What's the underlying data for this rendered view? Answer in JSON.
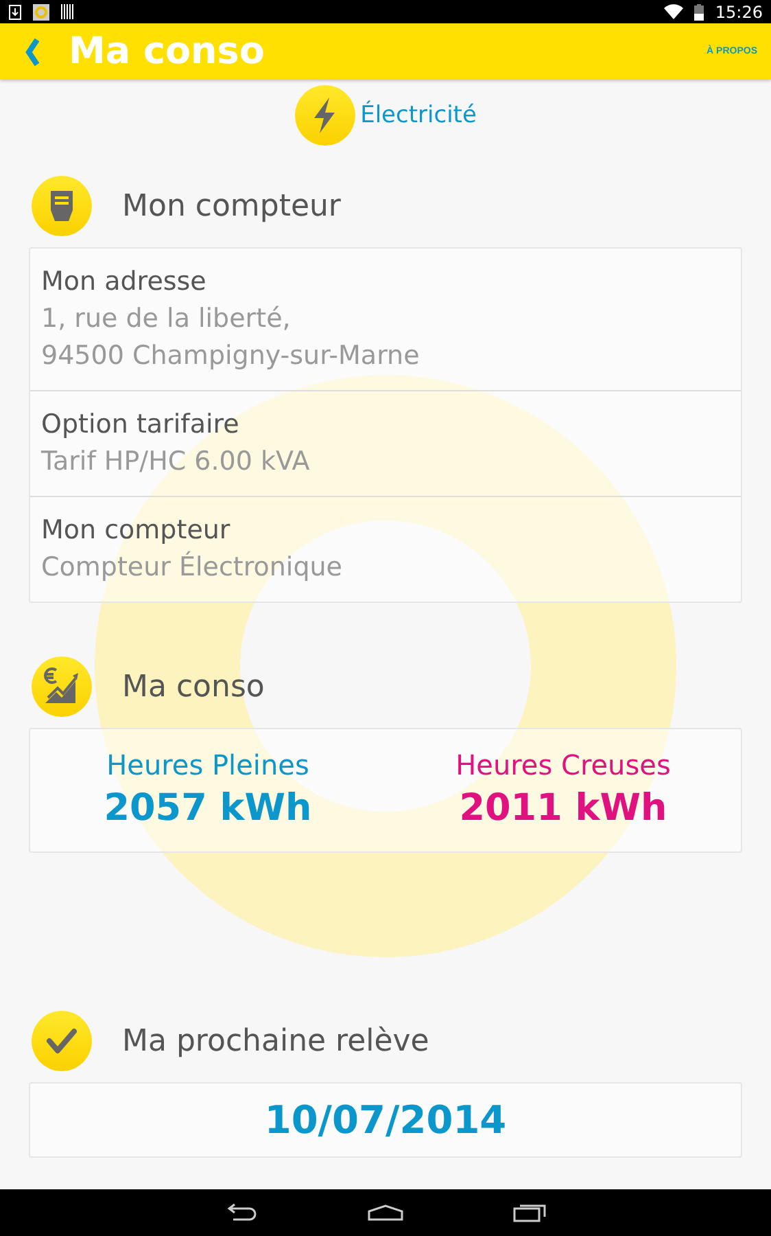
{
  "status_bar": {
    "time": "15:26"
  },
  "app_bar": {
    "title": "Ma conso",
    "action": "À PROPOS"
  },
  "energy": {
    "label": "Électricité"
  },
  "meter_section": {
    "title": "Mon compteur",
    "fields": [
      {
        "label": "Mon adresse",
        "lines": [
          "1, rue de la liberté,",
          "94500 Champigny-sur-Marne"
        ]
      },
      {
        "label": "Option tarifaire",
        "lines": [
          "Tarif HP/HC 6.00 kVA"
        ]
      },
      {
        "label": "Mon compteur",
        "lines": [
          "Compteur Électronique"
        ]
      }
    ]
  },
  "consumption_section": {
    "title": "Ma conso",
    "items": [
      {
        "label": "Heures Pleines",
        "value": "2057 kWh",
        "color": "#0b97cc"
      },
      {
        "label": "Heures Creuses",
        "value": "2011 kWh",
        "color": "#e0127f"
      }
    ]
  },
  "reading_section": {
    "title": "Ma prochaine relève",
    "date": "10/07/2014"
  }
}
